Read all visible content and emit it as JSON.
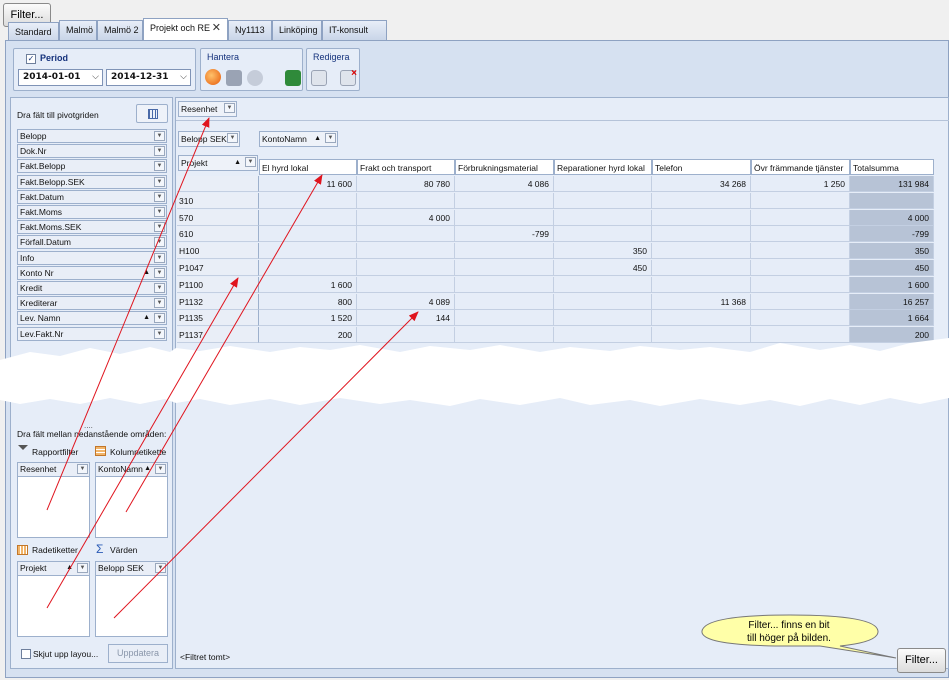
{
  "top_filter_button": "Filter...",
  "tabs": [
    {
      "label": "Standard",
      "active": false
    },
    {
      "label": "Malmö",
      "active": false
    },
    {
      "label": "Malmö 2",
      "active": false
    },
    {
      "label": "Projekt och RE",
      "active": true
    },
    {
      "label": "Ny1113",
      "active": false
    },
    {
      "label": "Linköping",
      "active": false
    },
    {
      "label": "IT-konsult",
      "active": false
    }
  ],
  "close_glyph": "✕",
  "period": {
    "label": "Period",
    "from": "2014-01-01",
    "to": "2014-12-31",
    "dropdown_glyph": "⌵"
  },
  "hantera": {
    "label": "Hantera"
  },
  "redigera": {
    "label": "Redigera"
  },
  "left_panel": {
    "drag_label": "Dra fält till pivotgriden",
    "fields": [
      "Belopp",
      "Dok.Nr",
      "Fakt.Belopp",
      "Fakt.Belopp.SEK",
      "Fakt.Datum",
      "Fakt.Moms",
      "Fakt.Moms.SEK",
      "Förfall.Datum",
      "Info",
      "Konto Nr",
      "Kredit",
      "Krediterar",
      "Lev. Namn",
      "Lev.Fakt.Nr"
    ],
    "sort_fields": [
      "Konto Nr",
      "Lev. Namn"
    ],
    "areas_label": "Dra fält mellan nedanstående områden:",
    "report_filter_label": "Rapportfilter",
    "column_label": "Kolumnetikette",
    "row_label": "Radetiketter",
    "values_label": "Värden",
    "report_filter_item": "Resenhet",
    "column_item": "KontoNamn",
    "row_item": "Projekt",
    "values_item": "Belopp SEK",
    "defer_label": "Skjut upp layou...",
    "update_button": "Uppdatera",
    "dots": "....",
    "sort_glyph": "▲"
  },
  "grid": {
    "filter_chip": "Resenhet",
    "data_chip": "Belopp SEK",
    "column_chip": "KontoNamn",
    "row_chip": "Projekt",
    "columns": [
      "El hyrd lokal",
      "Frakt och transport",
      "Förbrukningsmaterial",
      "Reparationer hyrd lokal",
      "Telefon",
      "Övr främmande tjänster",
      "Totalsumma"
    ],
    "rows": [
      {
        "label": "",
        "values": [
          "11 600",
          "80 780",
          "4 086",
          "",
          "34 268",
          "1 250",
          "131 984"
        ]
      },
      {
        "label": "310",
        "values": [
          "",
          "",
          "",
          "",
          "",
          "",
          ""
        ]
      },
      {
        "label": "570",
        "values": [
          "",
          "4 000",
          "",
          "",
          "",
          "",
          "4 000"
        ]
      },
      {
        "label": "610",
        "values": [
          "",
          "",
          "-799",
          "",
          "",
          "",
          "-799"
        ]
      },
      {
        "label": "H100",
        "values": [
          "",
          "",
          "",
          "350",
          "",
          "",
          "350"
        ]
      },
      {
        "label": "P1047",
        "values": [
          "",
          "",
          "",
          "450",
          "",
          "",
          "450"
        ]
      },
      {
        "label": "P1100",
        "values": [
          "1 600",
          "",
          "",
          "",
          "",
          "",
          "1 600"
        ]
      },
      {
        "label": "P1132",
        "values": [
          "800",
          "4 089",
          "",
          "",
          "11 368",
          "",
          "16 257"
        ]
      },
      {
        "label": "P1135",
        "values": [
          "1 520",
          "144",
          "",
          "",
          "",
          "",
          "1 664"
        ]
      },
      {
        "label": "P1137",
        "values": [
          "200",
          "",
          "",
          "",
          "",
          "",
          "200"
        ]
      }
    ],
    "filter_status": "<Filtret tomt>"
  },
  "callout": {
    "line1": "Filter... finns en bit",
    "line2": "till höger på bilden."
  },
  "bottom_filter_button": "Filter...",
  "colors": {
    "arrow": "#e0141e",
    "callout_fill": "#ffffa8",
    "accent": "#15327c"
  }
}
